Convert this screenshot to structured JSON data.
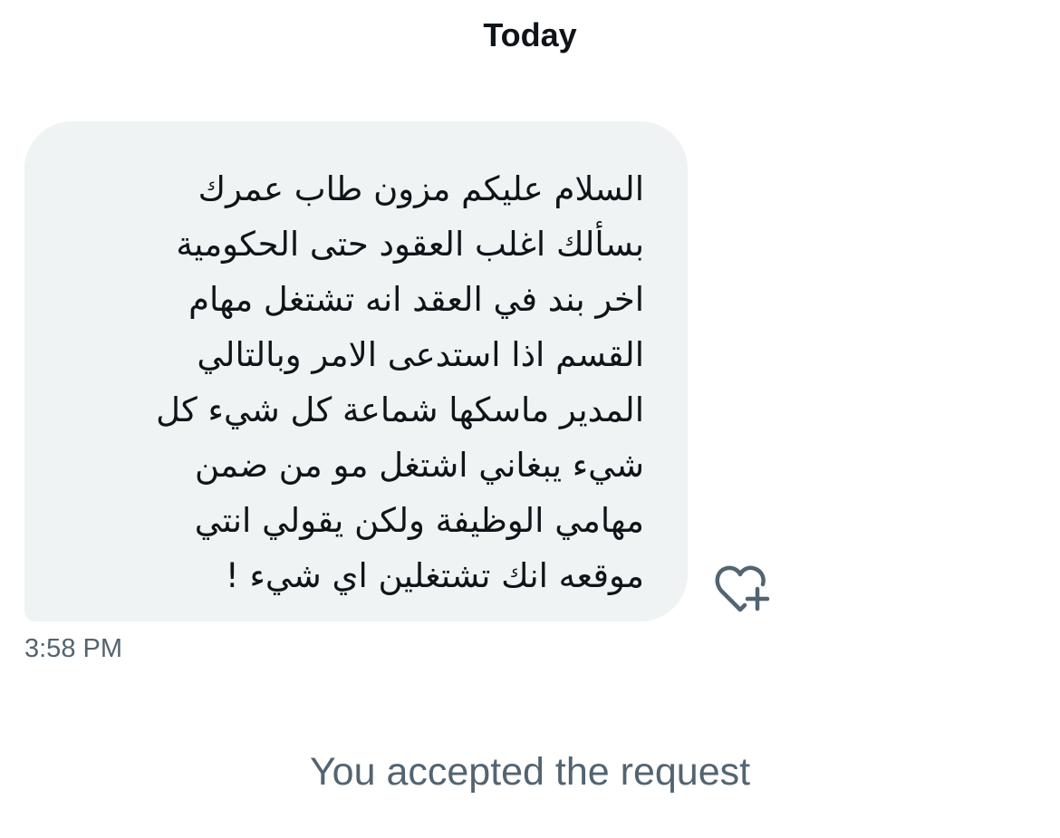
{
  "conversation": {
    "date_header": "Today",
    "messages": [
      {
        "text": "السلام عليكم مزون طاب عمرك\nبسألك اغلب العقود حتى الحكومية\nاخر بند في العقد انه تشتغل مهام\nالقسم اذا استدعى الامر وبالتالي\nالمدير ماسكها شماعة كل شيء كل\nشيء يبغاني اشتغل مو من ضمن\nمهامي الوظيفة ولكن يقولي انتي\nموقعه انك تشتغلين اي شيء !",
        "timestamp": "3:58 PM",
        "reaction_icon": "heart-plus-icon"
      }
    ],
    "system_message": "You accepted the request"
  },
  "colors": {
    "bubble_bg": "#eff3f4",
    "text_primary": "#0f1419",
    "text_secondary": "#536471"
  }
}
